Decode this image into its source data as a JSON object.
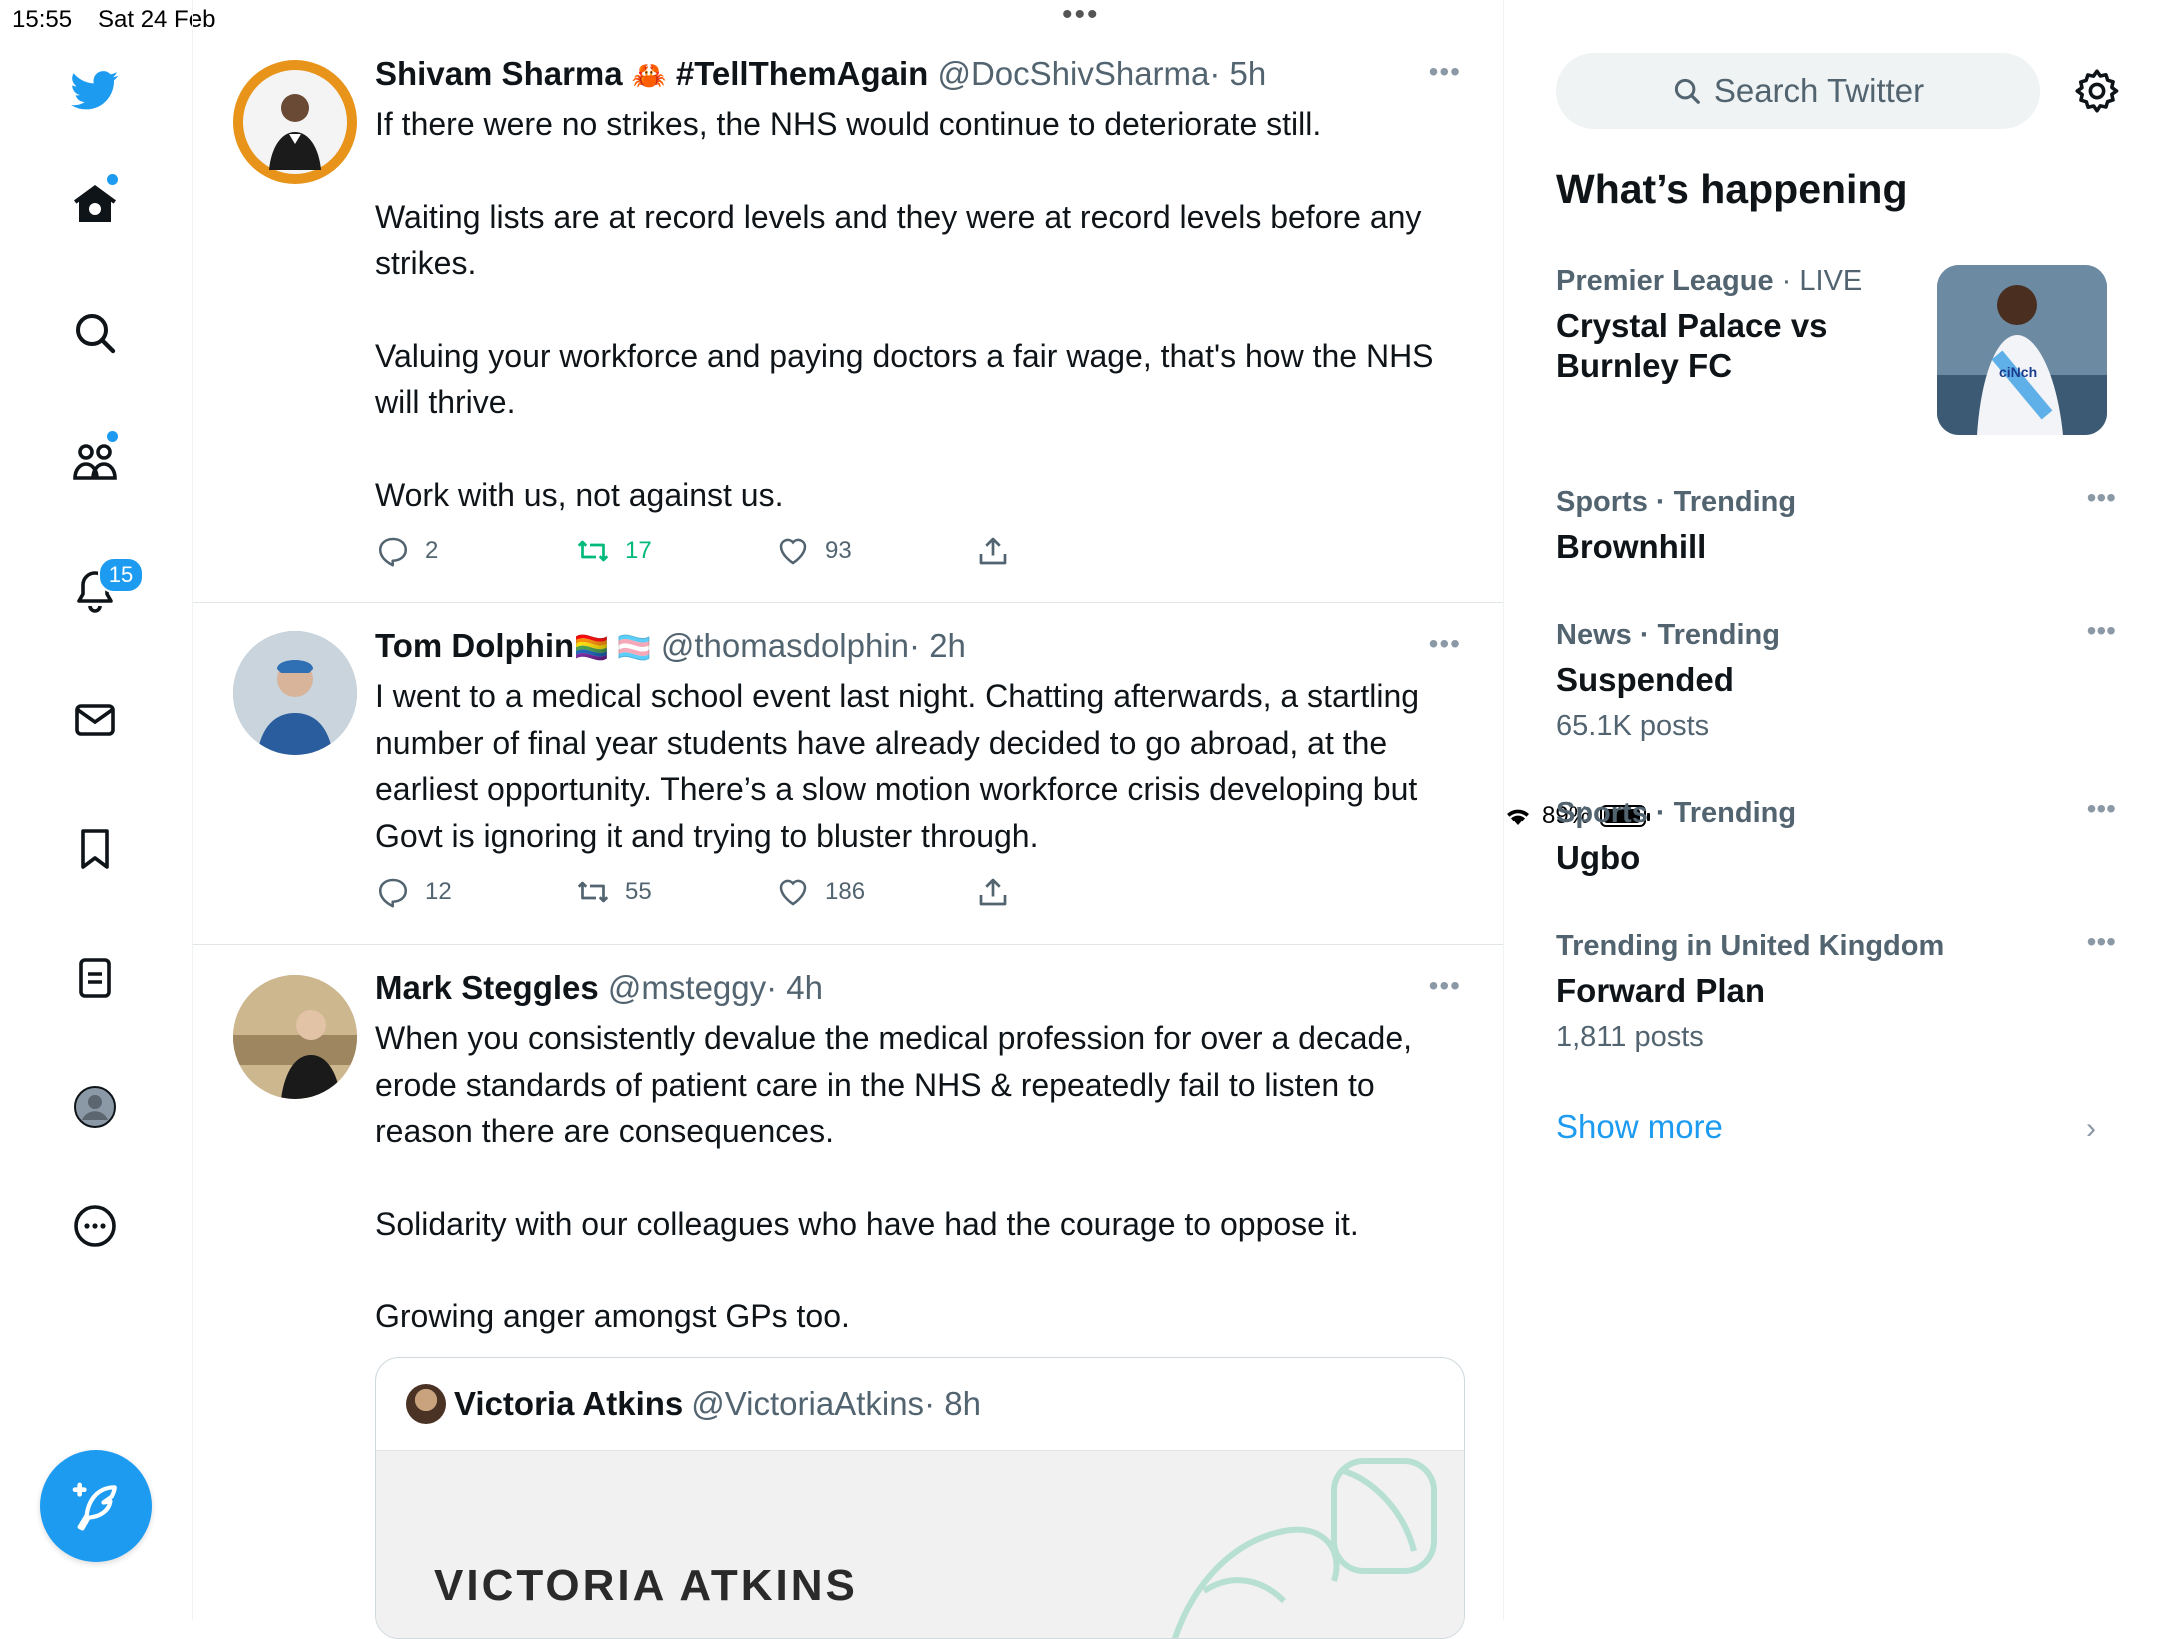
{
  "status_bar": {
    "time": "15:55",
    "date": "Sat 24 Feb",
    "battery": "89%"
  },
  "nav": {
    "items": [
      "twitter-logo",
      "home",
      "explore",
      "communities",
      "notifications",
      "messages",
      "bookmarks",
      "lists",
      "profile",
      "more"
    ],
    "notifications_count": "15"
  },
  "tweets": [
    {
      "name": "Shivam Sharma",
      "emoji": "🦀",
      "name_suffix": "#TellThemAgain",
      "handle": "@DocShivSharma",
      "time": "· 5h",
      "paragraphs": [
        "If there were no strikes, the NHS would continue to deteriorate still.",
        "Waiting lists are at record levels and they were at record levels before any strikes.",
        "Valuing your workforce and paying doctors a fair wage, that's how the NHS will thrive.",
        "Work with us, not against us."
      ],
      "replies": "2",
      "retweets": "17",
      "likes": "93",
      "retweeted": true
    },
    {
      "name": "Tom Dolphin",
      "emoji": "🏳️‍🌈 🏳️‍⚧️",
      "handle": "@thomasdolphin",
      "time": "· 2h",
      "paragraphs": [
        "I went to a medical school event last night. Chatting afterwards, a startling number of final year students have already decided to go abroad, at the earliest opportunity. There’s a slow motion workforce crisis developing but  Govt is ignoring it and trying to bluster through."
      ],
      "replies": "12",
      "retweets": "55",
      "likes": "186",
      "retweeted": false
    },
    {
      "name": "Mark Steggles",
      "handle": "@msteggy",
      "time": "· 4h",
      "paragraphs": [
        "When you consistently devalue the medical profession for over a decade, erode standards of patient care in the NHS & repeatedly fail to listen to reason there are consequences.",
        "Solidarity with our colleagues who have had the courage to oppose it.",
        "Growing anger amongst GPs too."
      ],
      "quote": {
        "name": "Victoria Atkins",
        "handle": "@VictoriaAtkins",
        "time": "· 8h",
        "image_text": "VICTORIA ATKINS"
      }
    }
  ],
  "sidebar": {
    "search_placeholder": "Search Twitter",
    "heading": "What’s happening",
    "trends": [
      {
        "category": "Premier League",
        "meta_suffix": "· LIVE",
        "title": "Crystal Palace vs Burnley FC",
        "posts": ""
      },
      {
        "category": "Sports · Trending",
        "meta_suffix": "",
        "title": "Brownhill",
        "posts": ""
      },
      {
        "category": "News · Trending",
        "meta_suffix": "",
        "title": "Suspended",
        "posts": "65.1K posts"
      },
      {
        "category": "Sports · Trending",
        "meta_suffix": "",
        "title": "Ugbo",
        "posts": ""
      },
      {
        "category": "Trending in United Kingdom",
        "meta_suffix": "",
        "title": "Forward Plan",
        "posts": "1,811 posts"
      }
    ],
    "show_more": "Show more"
  },
  "colors": {
    "accent": "#1d9bf0",
    "retweet_active": "#00ba7c",
    "secondary_text": "#536471"
  }
}
